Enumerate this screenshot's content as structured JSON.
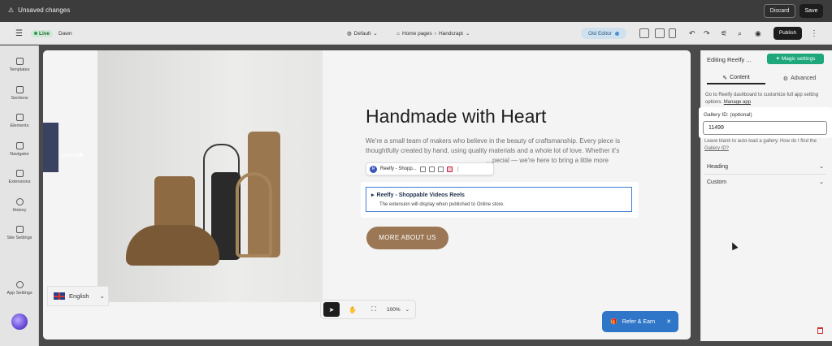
{
  "topbar": {
    "status": "Unsaved changes",
    "discard": "Discard",
    "save": "Save"
  },
  "toolbar": {
    "live": "Live",
    "theme": "Dawn",
    "default": "Default",
    "home_pages": "Home pages",
    "handcrapt": "Handcrapt",
    "old_editor": "Old Editor",
    "publish": "Publish"
  },
  "left_rail": {
    "items": [
      "Templates",
      "Sections",
      "Elements",
      "Navigator",
      "Extensions",
      "History",
      "Site Settings",
      "App Settings"
    ]
  },
  "canvas": {
    "reviews_tab": "Reviews",
    "heading": "Handmade with Heart",
    "body_1": "We're a small team of makers who believe in the beauty of craftsmanship. Every piece is",
    "body_2": "thoughtfully created by hand, using quality materials and a whole lot of love. Whether it's",
    "body_3": "…pecial — we're here to bring a little more",
    "context_app": "Reelfy - Shopp...",
    "block_title": "Reelfy - Shoppable Videos Reels",
    "block_sub": "The extension will display when published to Online store.",
    "more_button": "MORE ABOUT US",
    "language": "English",
    "zoom": "100%",
    "refer": "Refer & Earn"
  },
  "right_panel": {
    "title": "Editing Reelfy ...",
    "magic": "Magic settings",
    "tab_content": "Content",
    "tab_advanced": "Advanced",
    "help_1": "Go to Reelfy dashboard to customize full app setting options.",
    "manage_app": "Manage app",
    "gallery_label": "Gallery ID: (optional)",
    "gallery_value": "11499",
    "help_2": "Leave blank to auto-load a gallery. How do I find the",
    "gallery_link": "Gallery ID?",
    "heading": "Heading",
    "custom": "Custom"
  }
}
